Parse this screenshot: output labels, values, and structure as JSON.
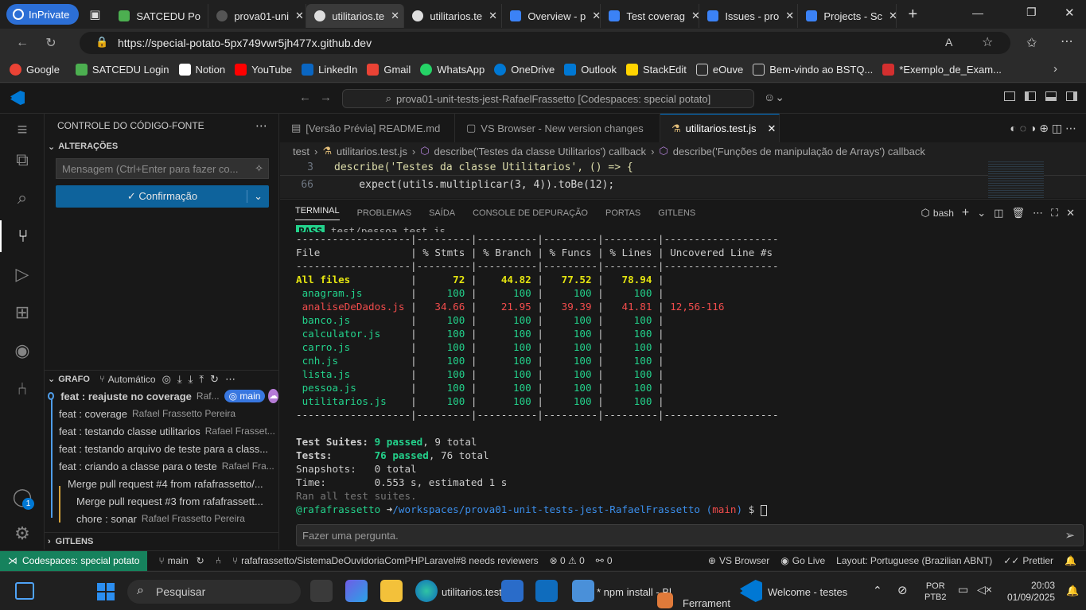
{
  "browser": {
    "inprivate": "InPrivate",
    "tabs": [
      {
        "label": "SATCEDU Po",
        "color": "#4caf50"
      },
      {
        "label": "prova01-uni",
        "color": "#888888"
      },
      {
        "label": "utilitarios.te",
        "color": "#888888"
      },
      {
        "label": "utilitarios.te",
        "color": "#888888"
      },
      {
        "label": "Overview - p",
        "color": "#3b82f6"
      },
      {
        "label": "Test coverag",
        "color": "#3b82f6"
      },
      {
        "label": "Issues - pro",
        "color": "#3b82f6"
      },
      {
        "label": "Projects - Sc",
        "color": "#3b82f6"
      }
    ],
    "url": "https://special-potato-5px749vwr5jh477x.github.dev",
    "bookmarks": [
      {
        "label": "Google",
        "color": "#ea4335"
      },
      {
        "label": "SATCEDU Login",
        "color": "#4caf50"
      },
      {
        "label": "Notion",
        "color": "#ffffff"
      },
      {
        "label": "YouTube",
        "color": "#ff0000"
      },
      {
        "label": "LinkedIn",
        "color": "#0a66c2"
      },
      {
        "label": "Gmail",
        "color": "#ea4335"
      },
      {
        "label": "WhatsApp",
        "color": "#25d366"
      },
      {
        "label": "OneDrive",
        "color": "#0078d4"
      },
      {
        "label": "Outlook",
        "color": "#0078d4"
      },
      {
        "label": "StackEdit",
        "color": "#ffd400"
      },
      {
        "label": "eOuve",
        "color": "#cccccc"
      },
      {
        "label": "Bem-vindo ao BSTQ...",
        "color": "#cccccc"
      },
      {
        "label": "*Exemplo_de_Exam...",
        "color": "#d32f2f"
      }
    ]
  },
  "vscode": {
    "command_center": "prova01-unit-tests-jest-RafaelFrassetto [Codespaces: special potato]",
    "sidebar": {
      "title": "CONTROLE DO CÓDIGO-FONTE",
      "changes_header": "ALTERAÇÕES",
      "message_placeholder": "Mensagem (Ctrl+Enter para fazer co...",
      "commit_label": "✓ Confirmação",
      "graph_header": "GRAFO",
      "graph_mode": "Automático",
      "branch_badge": "main",
      "commits": [
        {
          "msg": "feat : reajuste no coverage",
          "author": "Raf..."
        },
        {
          "msg": "feat : coverage",
          "author": "Rafael Frassetto Pereira"
        },
        {
          "msg": "feat : testando classe utilitarios",
          "author": "Rafael Frasset..."
        },
        {
          "msg": "feat : testando arquivo de teste para a class...",
          "author": ""
        },
        {
          "msg": "feat : criando a classe para o teste",
          "author": "Rafael Fra..."
        },
        {
          "msg": "Merge pull request #4 from rafafrassetto/...",
          "author": ""
        },
        {
          "msg": "Merge pull request #3 from rafafrassett...",
          "author": ""
        },
        {
          "msg": "chore : sonar",
          "author": "Rafael Frassetto Pereira"
        }
      ],
      "gitlens_header": "GITLENS"
    },
    "editor": {
      "tabs": [
        "[Versão Prévia] README.md",
        "VS Browser - New version changes",
        "utilitarios.test.js"
      ],
      "breadcrumbs": [
        "test",
        "utilitarios.test.js",
        "describe('Testes da classe Utilitarios') callback",
        "describe('Funções de manipulação de Arrays') callback"
      ],
      "lines": [
        {
          "num": "3",
          "text": "describe('Testes da classe Utilitarios', () => {"
        },
        {
          "num": "66",
          "text": "    expect(utils.multiplicar(3, 4)).toBe(12);"
        }
      ]
    },
    "panel": {
      "tabs": [
        "TERMINAL",
        "PROBLEMAS",
        "SAÍDA",
        "CONSOLE DE DEPURAÇÃO",
        "PORTAS",
        "GITLENS"
      ],
      "shell": "bash",
      "pass_badge": "PASS",
      "pass_file": " test/pessoa.test.js",
      "separator": "-------------------|---------|----------|---------|---------|-------------------",
      "header": [
        "File",
        "% Stmts",
        "% Branch",
        "% Funcs",
        "% Lines",
        "Uncovered Line #s"
      ],
      "rows": [
        {
          "file": "All files",
          "stmts": "72",
          "branch": "44.82",
          "funcs": "77.52",
          "lines": "78.94",
          "uncovered": ""
        },
        {
          "file": " anagram.js",
          "stmts": "100",
          "branch": "100",
          "funcs": "100",
          "lines": "100",
          "uncovered": ""
        },
        {
          "file": " analiseDeDados.js",
          "stmts": "34.66",
          "branch": "21.95",
          "funcs": "39.39",
          "lines": "41.81",
          "uncovered": "12,56-116"
        },
        {
          "file": " banco.js",
          "stmts": "100",
          "branch": "100",
          "funcs": "100",
          "lines": "100",
          "uncovered": ""
        },
        {
          "file": " calculator.js",
          "stmts": "100",
          "branch": "100",
          "funcs": "100",
          "lines": "100",
          "uncovered": ""
        },
        {
          "file": " carro.js",
          "stmts": "100",
          "branch": "100",
          "funcs": "100",
          "lines": "100",
          "uncovered": ""
        },
        {
          "file": " cnh.js",
          "stmts": "100",
          "branch": "100",
          "funcs": "100",
          "lines": "100",
          "uncovered": ""
        },
        {
          "file": " lista.js",
          "stmts": "100",
          "branch": "100",
          "funcs": "100",
          "lines": "100",
          "uncovered": ""
        },
        {
          "file": " pessoa.js",
          "stmts": "100",
          "branch": "100",
          "funcs": "100",
          "lines": "100",
          "uncovered": ""
        },
        {
          "file": " utilitarios.js",
          "stmts": "100",
          "branch": "100",
          "funcs": "100",
          "lines": "100",
          "uncovered": ""
        }
      ],
      "summary": {
        "suites_label": "Test Suites: ",
        "suites_passed": "9 passed",
        "suites_total": ", 9 total",
        "tests_label": "Tests:       ",
        "tests_passed": "76 passed",
        "tests_total": ", 76 total",
        "snap": "Snapshots:   0 total",
        "time": "Time:        0.553 s, estimated 1 s",
        "ran": "Ran all test suites."
      },
      "prompt_user": "@rafafrassetto ",
      "prompt_arrow": "➜",
      "prompt_path": "/workspaces/prova01-unit-tests-jest-RafaelFrassetto",
      "prompt_branch_open": " (",
      "prompt_branch": "main",
      "prompt_branch_close": ")",
      "prompt_end": " $ ",
      "ask_placeholder": "Fazer uma pergunta."
    },
    "status": {
      "remote": "Codespaces: special potato",
      "branch": "main",
      "pr": "rafafrassetto/SistemaDeOuvidoriaComPHPLaravel#8 needs reviewers",
      "problems": "⊗ 0 ⚠ 0",
      "ports": "0",
      "vs_browser": "VS Browser",
      "go_live": "Go Live",
      "layout": "Layout: Portuguese (Brazilian ABNT)",
      "prettier": "Prettier",
      "accounts_badge": "1"
    }
  },
  "taskbar": {
    "search": "Pesquisar",
    "edge_label": "utilitarios.test",
    "npm_label": "* npm install - Bl",
    "paint_label": "Ferrament",
    "vscode_label": "Welcome - testes",
    "lang1": "POR",
    "lang2": "PTB2",
    "time": "20:03",
    "date": "01/09/2025"
  }
}
